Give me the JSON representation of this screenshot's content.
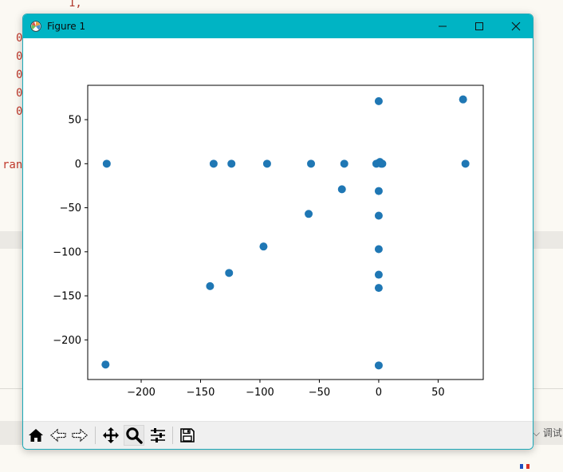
{
  "background_editor": {
    "top_fragment": "1,",
    "code_lines": [
      "0",
      "0",
      "0",
      "0",
      "0"
    ],
    "range_fragment": "ran",
    "right_panel_label": "调试"
  },
  "window": {
    "title": "Figure 1",
    "titlebar_color": "#00b4c4",
    "icon": "matplotlib-figure-icon",
    "controls": {
      "minimize_icon": "minimize-icon",
      "maximize_icon": "maximize-icon",
      "close_icon": "close-icon"
    }
  },
  "toolbar": {
    "tools": [
      {
        "name": "home",
        "icon": "home-icon"
      },
      {
        "name": "back",
        "icon": "back-arrow-icon"
      },
      {
        "name": "forward",
        "icon": "forward-arrow-icon"
      },
      {
        "name": "pan",
        "icon": "move-icon"
      },
      {
        "name": "zoom",
        "icon": "zoom-icon",
        "active": true
      },
      {
        "name": "configure-subplots",
        "icon": "sliders-icon"
      },
      {
        "name": "save",
        "icon": "save-icon"
      }
    ]
  },
  "chart_data": {
    "type": "scatter",
    "title": "",
    "xlabel": "",
    "ylabel": "",
    "xlim": [
      -245,
      88
    ],
    "ylim": [
      -245,
      89
    ],
    "grid": false,
    "marker_color": "#1f77b4",
    "xticks": [
      -200,
      -150,
      -100,
      -50,
      0,
      50
    ],
    "xtick_labels": [
      "−200",
      "−150",
      "−100",
      "−50",
      "0",
      "50"
    ],
    "yticks": [
      50,
      0,
      -50,
      -100,
      -150,
      -200
    ],
    "ytick_labels": [
      "50",
      "0",
      "−50",
      "−100",
      "−150",
      "−200"
    ],
    "points": [
      {
        "x": -229,
        "y": 0
      },
      {
        "x": -139,
        "y": 0
      },
      {
        "x": -124,
        "y": 0
      },
      {
        "x": -94,
        "y": 0
      },
      {
        "x": -57,
        "y": 0
      },
      {
        "x": -29,
        "y": 0
      },
      {
        "x": -2,
        "y": 0
      },
      {
        "x": 0,
        "y": 1
      },
      {
        "x": 1,
        "y": 2
      },
      {
        "x": 2,
        "y": 0
      },
      {
        "x": 3,
        "y": 0
      },
      {
        "x": 73,
        "y": 0
      },
      {
        "x": 0,
        "y": 71
      },
      {
        "x": 71,
        "y": 73
      },
      {
        "x": -31,
        "y": -29
      },
      {
        "x": -59,
        "y": -57
      },
      {
        "x": -97,
        "y": -94
      },
      {
        "x": -126,
        "y": -124
      },
      {
        "x": -142,
        "y": -139
      },
      {
        "x": -230,
        "y": -228
      },
      {
        "x": 0,
        "y": -31
      },
      {
        "x": 0,
        "y": -59
      },
      {
        "x": 0,
        "y": -97
      },
      {
        "x": 0,
        "y": -126
      },
      {
        "x": 0,
        "y": -141
      },
      {
        "x": 0,
        "y": -229
      }
    ]
  }
}
